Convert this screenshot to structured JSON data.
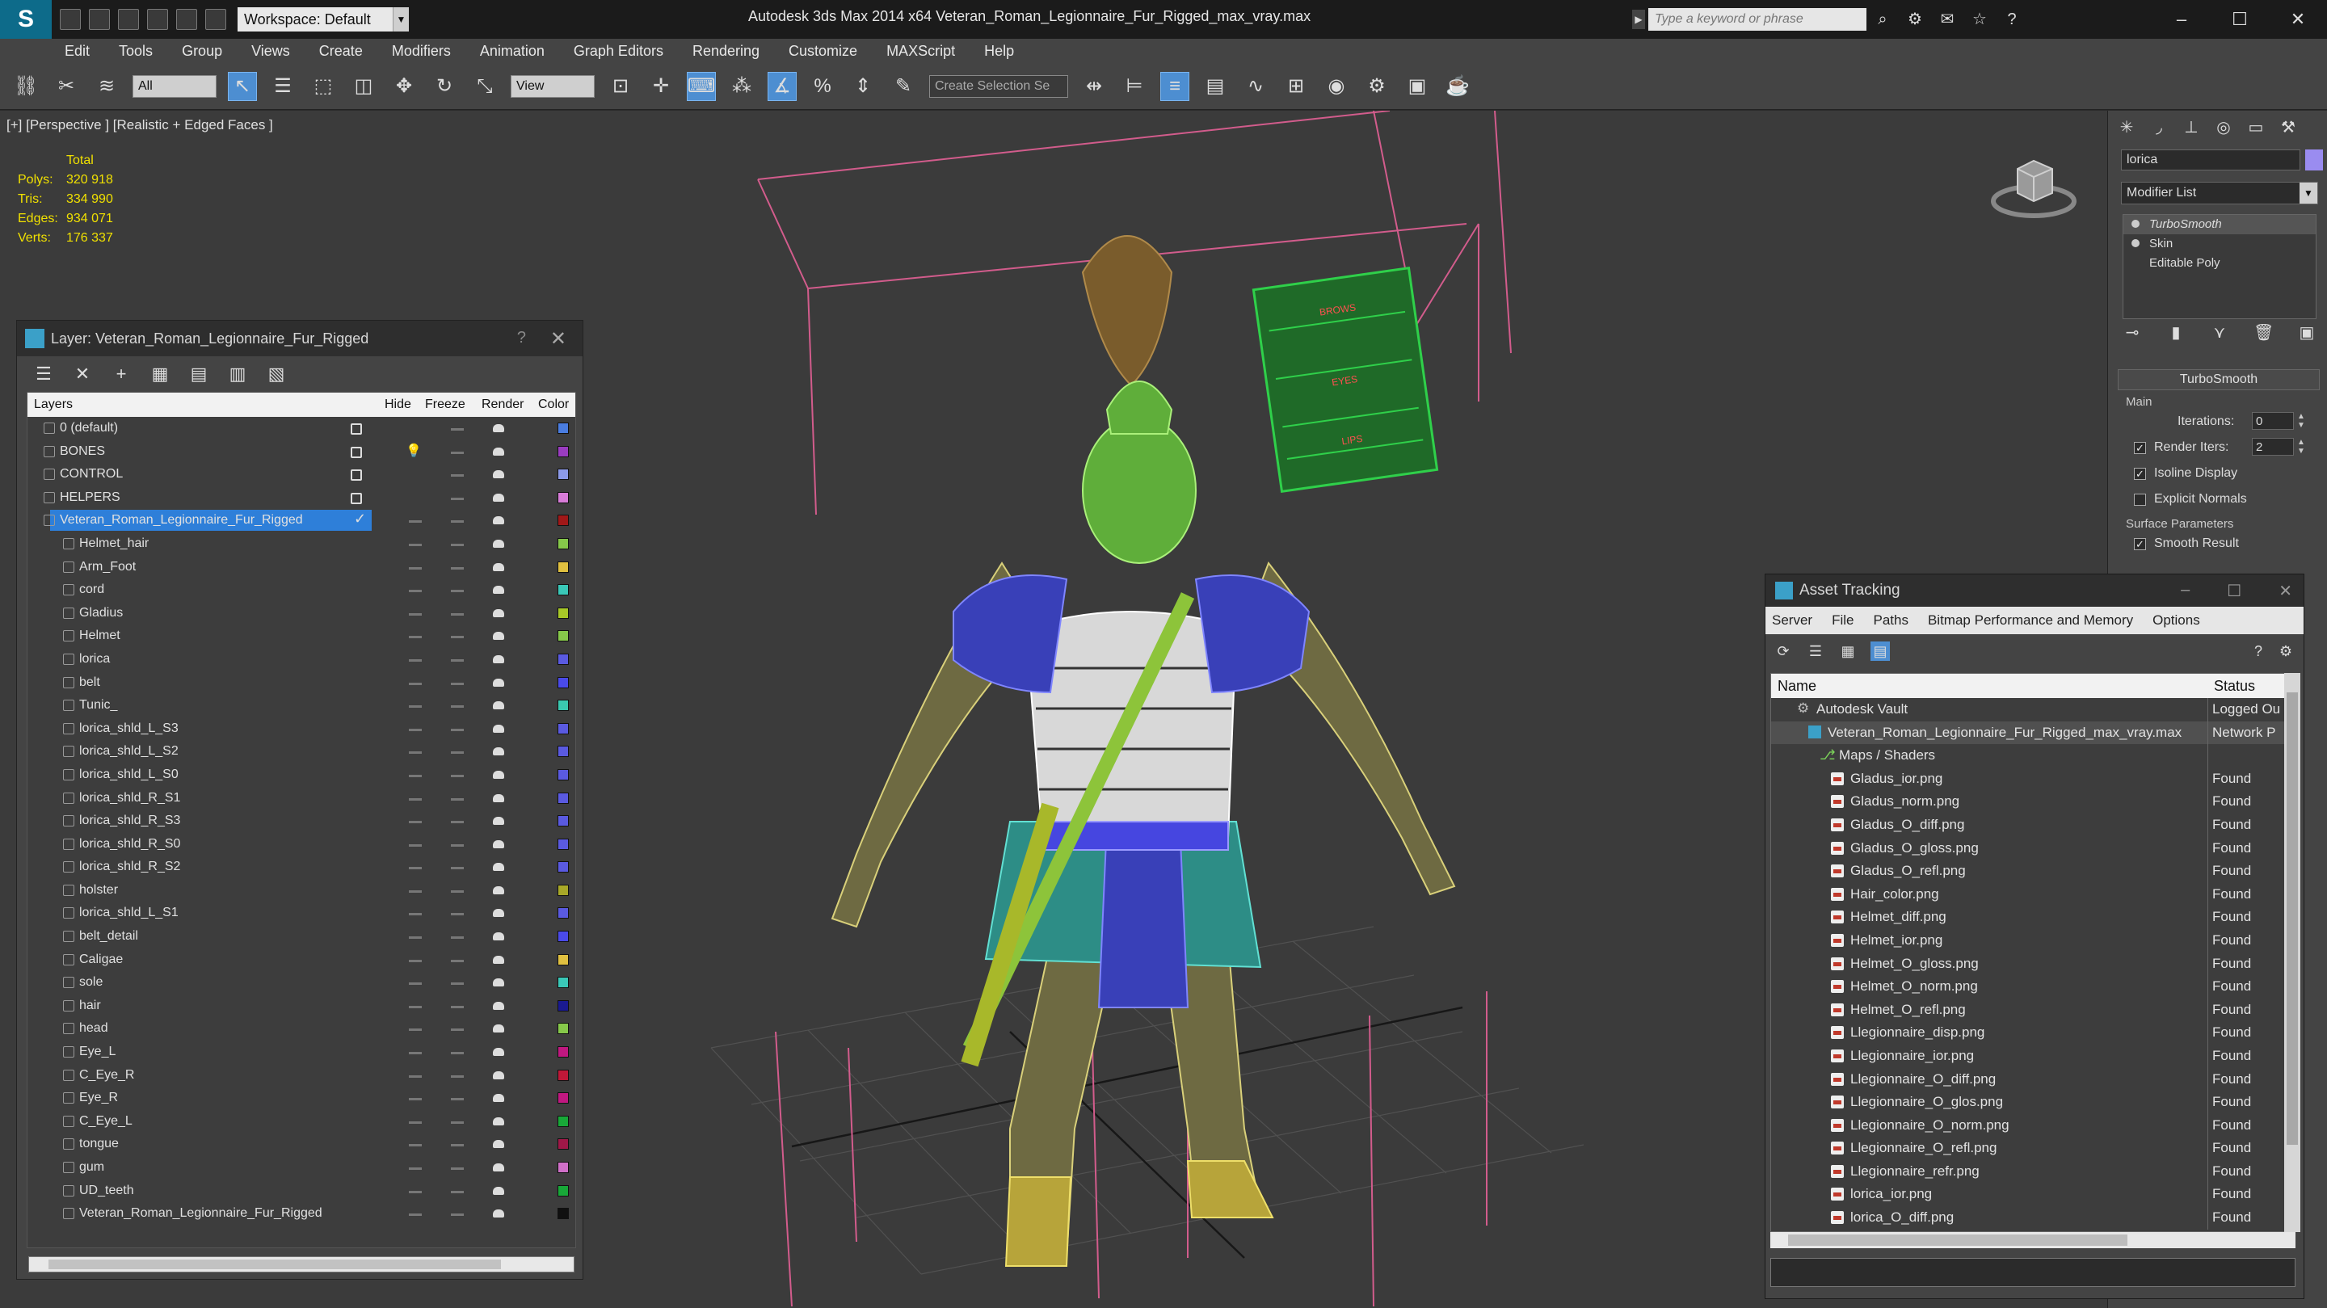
{
  "window": {
    "title": "Autodesk 3ds Max  2014 x64      Veteran_Roman_Legionnaire_Fur_Rigged_max_vray.max",
    "workspace_label": "Workspace: Default",
    "search_placeholder": "Type a keyword or phrase"
  },
  "menu": [
    "Edit",
    "Tools",
    "Group",
    "Views",
    "Create",
    "Modifiers",
    "Animation",
    "Graph Editors",
    "Rendering",
    "Customize",
    "MAXScript",
    "Help"
  ],
  "toolbar": {
    "filter_value": "All",
    "refcoord_value": "View",
    "selection_set_placeholder": "Create Selection Se"
  },
  "viewport": {
    "label": "[+] [Perspective ] [Realistic + Edged Faces ]",
    "stats_header": "Total",
    "stats": [
      {
        "key": "Polys:",
        "value": "320 918"
      },
      {
        "key": "Tris:",
        "value": "334 990"
      },
      {
        "key": "Edges:",
        "value": "934 071"
      },
      {
        "key": "Verts:",
        "value": "176 337"
      }
    ],
    "board_lines": [
      "BROWS",
      "EYES",
      "LIPS"
    ]
  },
  "layer_window": {
    "title": "Layer: Veteran_Roman_Legionnaire_Fur_Rigged",
    "help": "?",
    "columns": {
      "layers": "Layers",
      "hide": "Hide",
      "freeze": "Freeze",
      "render": "Render",
      "color": "Color"
    },
    "rows": [
      {
        "name": "0 (default)",
        "level": 0,
        "hidden_box": true,
        "color": "#4a7de0"
      },
      {
        "name": "BONES",
        "level": 0,
        "hidden_box": true,
        "bulb": true,
        "color": "#9a3cc0"
      },
      {
        "name": "CONTROL",
        "level": 0,
        "hidden_box": true,
        "color": "#8c9ae8"
      },
      {
        "name": "HELPERS",
        "level": 0,
        "hidden_box": true,
        "color": "#d87cd8"
      },
      {
        "name": "Veteran_Roman_Legionnaire_Fur_Rigged",
        "level": 0,
        "selected": true,
        "color": "#a01818"
      },
      {
        "name": "Helmet_hair",
        "level": 1,
        "color": "#86c84a"
      },
      {
        "name": "Arm_Foot",
        "level": 1,
        "color": "#e0c040"
      },
      {
        "name": "cord",
        "level": 1,
        "color": "#3ac8b8"
      },
      {
        "name": "Gladius",
        "level": 1,
        "color": "#a8c828"
      },
      {
        "name": "Helmet",
        "level": 1,
        "color": "#86c84a"
      },
      {
        "name": "lorica",
        "level": 1,
        "color": "#5a5ae0"
      },
      {
        "name": "belt",
        "level": 1,
        "color": "#4a4ae8"
      },
      {
        "name": "Tunic_",
        "level": 1,
        "color": "#3ac8b0"
      },
      {
        "name": "lorica_shld_L_S3",
        "level": 1,
        "color": "#5a5ae0"
      },
      {
        "name": "lorica_shld_L_S2",
        "level": 1,
        "color": "#5a5ae0"
      },
      {
        "name": "lorica_shld_L_S0",
        "level": 1,
        "color": "#5a5ae0"
      },
      {
        "name": "lorica_shld_R_S1",
        "level": 1,
        "color": "#5a5ae0"
      },
      {
        "name": "lorica_shld_R_S3",
        "level": 1,
        "color": "#5a5ae0"
      },
      {
        "name": "lorica_shld_R_S0",
        "level": 1,
        "color": "#5a5ae0"
      },
      {
        "name": "lorica_shld_R_S2",
        "level": 1,
        "color": "#5a5ae0"
      },
      {
        "name": "holster",
        "level": 1,
        "color": "#a8a828"
      },
      {
        "name": "lorica_shld_L_S1",
        "level": 1,
        "color": "#5a5ae0"
      },
      {
        "name": "belt_detail",
        "level": 1,
        "color": "#4a4ae8"
      },
      {
        "name": "Caligae",
        "level": 1,
        "color": "#e0c040"
      },
      {
        "name": "sole",
        "level": 1,
        "color": "#3ac8b8"
      },
      {
        "name": "hair",
        "level": 1,
        "color": "#1a1a90"
      },
      {
        "name": "head",
        "level": 1,
        "color": "#86c84a"
      },
      {
        "name": "Eye_L",
        "level": 1,
        "color": "#c01880"
      },
      {
        "name": "C_Eye_R",
        "level": 1,
        "color": "#c01838"
      },
      {
        "name": "Eye_R",
        "level": 1,
        "color": "#c01880"
      },
      {
        "name": "C_Eye_L",
        "level": 1,
        "color": "#18a838"
      },
      {
        "name": "tongue",
        "level": 1,
        "color": "#a01848"
      },
      {
        "name": "gum",
        "level": 1,
        "color": "#d070c8"
      },
      {
        "name": "UD_teeth",
        "level": 1,
        "color": "#18a838"
      },
      {
        "name": "Veteran_Roman_Legionnaire_Fur_Rigged",
        "level": 1,
        "color": "#101010"
      }
    ]
  },
  "command_panel": {
    "object_name": "lorica",
    "object_color": "#9a8cf0",
    "modifier_list": "Modifier List",
    "stack": [
      "TurboSmooth",
      "Skin",
      "Editable Poly"
    ],
    "rollout_title": "TurboSmooth",
    "group_main": "Main",
    "iterations_label": "Iterations:",
    "iterations_value": "0",
    "render_iters_label": "Render Iters:",
    "render_iters_value": "2",
    "render_iters_checked": true,
    "isoline_label": "Isoline Display",
    "isoline_checked": true,
    "explicit_normals_label": "Explicit Normals",
    "explicit_normals_checked": false,
    "surface_group": "Surface Parameters",
    "smooth_result_label": "Smooth Result",
    "smooth_result_checked": true
  },
  "asset_tracking": {
    "title": "Asset Tracking",
    "menu": [
      "Server",
      "File",
      "Paths",
      "Bitmap Performance and Memory",
      "Options"
    ],
    "columns": {
      "name": "Name",
      "status": "Status"
    },
    "rows": [
      {
        "name": "Autodesk Vault",
        "status": "Logged Ou",
        "indent": 1,
        "type": "vault"
      },
      {
        "name": "Veteran_Roman_Legionnaire_Fur_Rigged_max_vray.max",
        "status": "Network P",
        "indent": 2,
        "type": "max"
      },
      {
        "name": "Maps / Shaders",
        "status": "",
        "indent": 3,
        "type": "folder"
      },
      {
        "name": "Gladus_ior.png",
        "status": "Found",
        "indent": 4,
        "type": "file"
      },
      {
        "name": "Gladus_norm.png",
        "status": "Found",
        "indent": 4,
        "type": "file"
      },
      {
        "name": "Gladus_O_diff.png",
        "status": "Found",
        "indent": 4,
        "type": "file"
      },
      {
        "name": "Gladus_O_gloss.png",
        "status": "Found",
        "indent": 4,
        "type": "file"
      },
      {
        "name": "Gladus_O_refl.png",
        "status": "Found",
        "indent": 4,
        "type": "file"
      },
      {
        "name": "Hair_color.png",
        "status": "Found",
        "indent": 4,
        "type": "file"
      },
      {
        "name": "Helmet_diff.png",
        "status": "Found",
        "indent": 4,
        "type": "file"
      },
      {
        "name": "Helmet_ior.png",
        "status": "Found",
        "indent": 4,
        "type": "file"
      },
      {
        "name": "Helmet_O_gloss.png",
        "status": "Found",
        "indent": 4,
        "type": "file"
      },
      {
        "name": "Helmet_O_norm.png",
        "status": "Found",
        "indent": 4,
        "type": "file"
      },
      {
        "name": "Helmet_O_refl.png",
        "status": "Found",
        "indent": 4,
        "type": "file"
      },
      {
        "name": "Llegionnaire_disp.png",
        "status": "Found",
        "indent": 4,
        "type": "file"
      },
      {
        "name": "Llegionnaire_ior.png",
        "status": "Found",
        "indent": 4,
        "type": "file"
      },
      {
        "name": "Llegionnaire_O_diff.png",
        "status": "Found",
        "indent": 4,
        "type": "file"
      },
      {
        "name": "Llegionnaire_O_glos.png",
        "status": "Found",
        "indent": 4,
        "type": "file"
      },
      {
        "name": "Llegionnaire_O_norm.png",
        "status": "Found",
        "indent": 4,
        "type": "file"
      },
      {
        "name": "Llegionnaire_O_refl.png",
        "status": "Found",
        "indent": 4,
        "type": "file"
      },
      {
        "name": "Llegionnaire_refr.png",
        "status": "Found",
        "indent": 4,
        "type": "file"
      },
      {
        "name": "lorica_ior.png",
        "status": "Found",
        "indent": 4,
        "type": "file"
      },
      {
        "name": "lorica_O_diff.png",
        "status": "Found",
        "indent": 4,
        "type": "file"
      }
    ]
  }
}
